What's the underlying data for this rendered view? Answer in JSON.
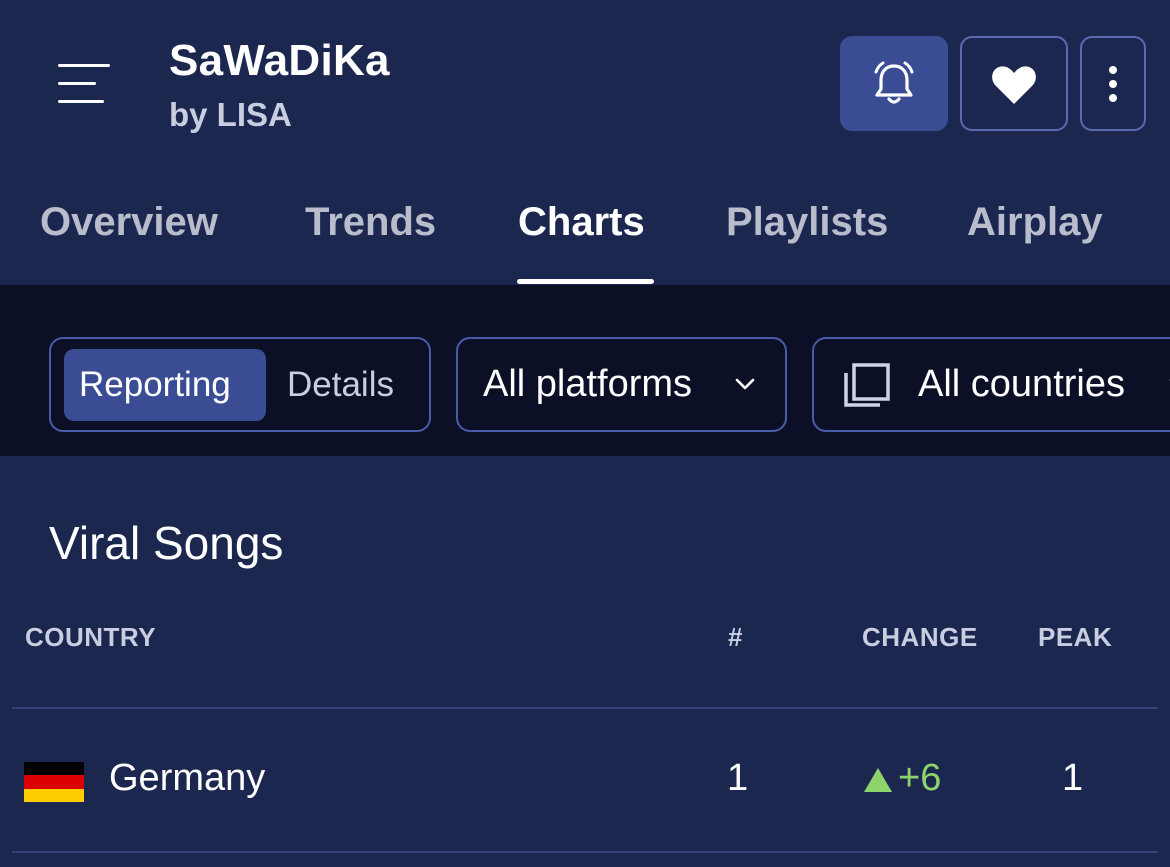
{
  "header": {
    "song_title": "SaWaDiKa",
    "artist": "by LISA"
  },
  "tabs": [
    {
      "label": "Overview"
    },
    {
      "label": "Trends"
    },
    {
      "label": "Charts",
      "active": true
    },
    {
      "label": "Playlists"
    },
    {
      "label": "Airplay"
    }
  ],
  "filters": {
    "view_toggle": {
      "options": [
        "Reporting",
        "Details"
      ],
      "selected": "Reporting"
    },
    "platform_dropdown": "All platforms",
    "country_dropdown": "All countries"
  },
  "section": {
    "title": "Viral Songs",
    "columns": [
      "COUNTRY",
      "#",
      "CHANGE",
      "PEAK"
    ],
    "rows": [
      {
        "country": "Germany",
        "flag": "germany-flag",
        "rank": "1",
        "change": "+6",
        "change_direction": "up",
        "peak": "1"
      }
    ]
  },
  "colors": {
    "background": "#1c2750",
    "filter_band": "#0b1026",
    "accent": "#3a4d94",
    "border": "#4a5ba8",
    "positive_change": "#8fd36c"
  }
}
